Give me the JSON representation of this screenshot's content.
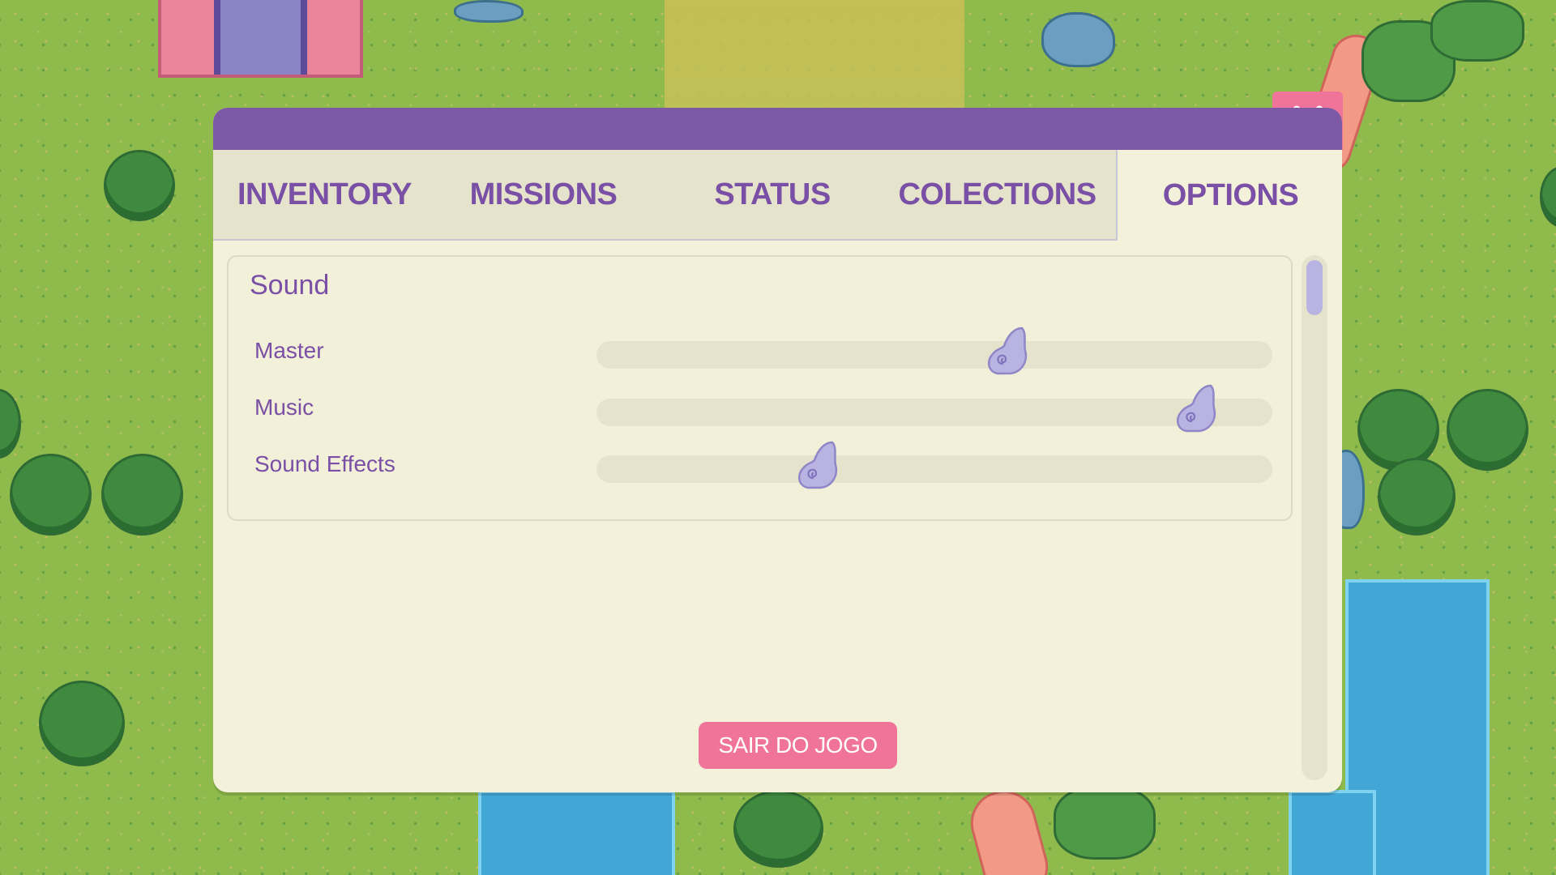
{
  "tabs": [
    {
      "label": "INVENTORY"
    },
    {
      "label": "MISSIONS"
    },
    {
      "label": "STATUS"
    },
    {
      "label": "COLECTIONS"
    },
    {
      "label": "OPTIONS",
      "active": true
    }
  ],
  "options": {
    "section_title": "Sound",
    "sliders": [
      {
        "label": "Master",
        "value": 0.61
      },
      {
        "label": "Music",
        "value": 0.89
      },
      {
        "label": "Sound Effects",
        "value": 0.33
      }
    ],
    "quit_label": "SAIR DO JOGO"
  },
  "icons": {
    "close": "close-icon",
    "slider_thumb": "snail-shell-icon"
  },
  "colors": {
    "header": "#7d59a5",
    "accent": "#f0739a",
    "text": "#7a4fa6",
    "panel": "#f3f1d9",
    "thumb": "#b8b3e0"
  }
}
